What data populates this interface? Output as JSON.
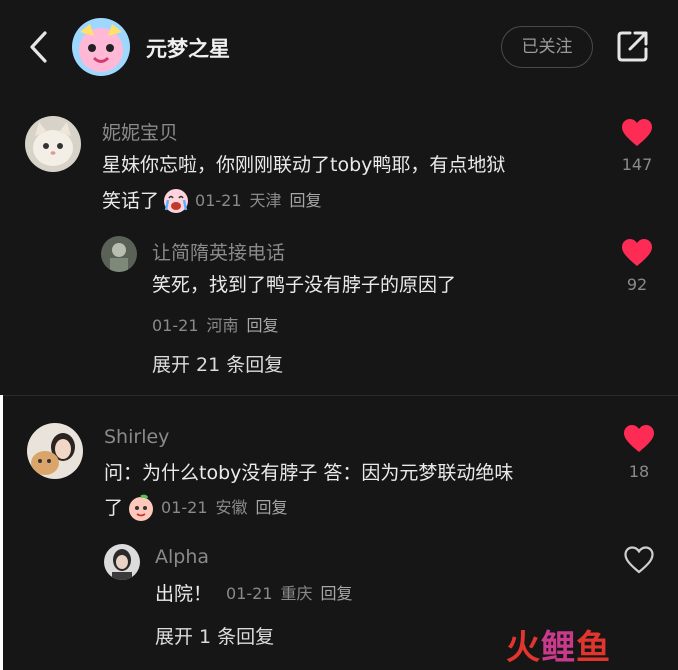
{
  "header": {
    "title": "元梦之星",
    "follow_label": "已关注",
    "icons": {
      "back": "chevron-left-icon",
      "share": "share-external-icon"
    }
  },
  "comments": [
    {
      "username": "妮妮宝贝",
      "text_line1": "星妹你忘啦，你刚刚联动了toby鸭耶，有点地狱",
      "text_line2": "笑话了",
      "emoji": "crying-emoji",
      "date": "01-21",
      "location": "天津",
      "reply_label": "回复",
      "likes": "147",
      "liked": true,
      "replies": [
        {
          "username": "让简隋英接电话",
          "text": "笑死，找到了鸭子没有脖子的原因了",
          "date": "01-21",
          "location": "河南",
          "reply_label": "回复",
          "likes": "92",
          "liked": true
        }
      ],
      "expand_label": "展开 21 条回复"
    },
    {
      "username": "Shirley",
      "text_line1": "问：为什么toby没有脖子  答：因为元梦联动绝味",
      "text_line2": "了",
      "emoji": "peach-emoji",
      "date": "01-21",
      "location": "安徽",
      "reply_label": "回复",
      "likes": "18",
      "liked": true,
      "replies": [
        {
          "username": "Alpha",
          "text": "出院！",
          "date": "01-21",
          "location": "重庆",
          "reply_label": "回复",
          "liked": false
        }
      ],
      "expand_label": "展开 1 条回复"
    }
  ],
  "watermark": {
    "text": "火鲤鱼"
  },
  "colors": {
    "like_red": "#fe2c55",
    "background": "#161616"
  }
}
